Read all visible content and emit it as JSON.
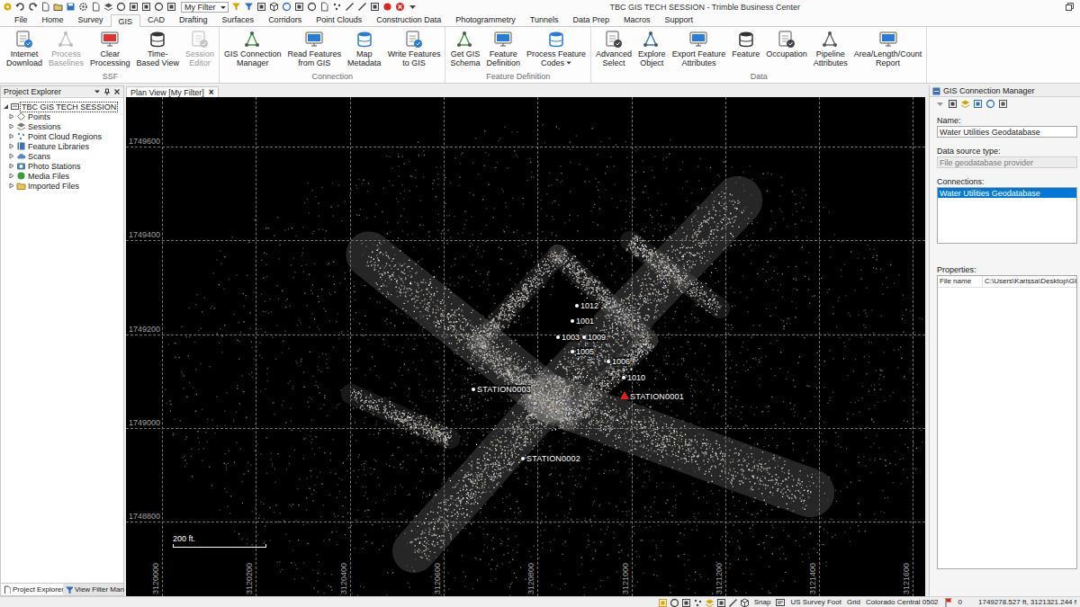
{
  "window": {
    "title": "TBC GIS TECH SESSION - Trimble Business Center"
  },
  "quick_access": {
    "filter": "My Filter"
  },
  "menu_tabs": [
    {
      "label": "File",
      "selected": false
    },
    {
      "label": "Home",
      "selected": false
    },
    {
      "label": "Survey",
      "selected": false
    },
    {
      "label": "GIS",
      "selected": true
    },
    {
      "label": "CAD",
      "selected": false
    },
    {
      "label": "Drafting",
      "selected": false
    },
    {
      "label": "Surfaces",
      "selected": false
    },
    {
      "label": "Corridors",
      "selected": false
    },
    {
      "label": "Point Clouds",
      "selected": false
    },
    {
      "label": "Construction Data",
      "selected": false
    },
    {
      "label": "Photogrammetry",
      "selected": false
    },
    {
      "label": "Tunnels",
      "selected": false
    },
    {
      "label": "Data Prep",
      "selected": false
    },
    {
      "label": "Macros",
      "selected": false
    },
    {
      "label": "Support",
      "selected": false
    }
  ],
  "ribbon": {
    "groups": [
      {
        "label": "SSF",
        "buttons": [
          {
            "lines": [
              "Internet",
              "Download"
            ],
            "disabled": false,
            "dropdown": false
          },
          {
            "lines": [
              "Process",
              "Baselines"
            ],
            "disabled": true,
            "dropdown": false
          },
          {
            "lines": [
              "Clear",
              "Processing"
            ],
            "disabled": false,
            "dropdown": false
          },
          {
            "lines": [
              "Time-",
              "Based View"
            ],
            "disabled": false,
            "dropdown": false
          },
          {
            "lines": [
              "Session",
              "Editor"
            ],
            "disabled": true,
            "dropdown": false
          }
        ]
      },
      {
        "label": "Connection",
        "buttons": [
          {
            "lines": [
              "GIS Connection",
              "Manager"
            ],
            "disabled": false,
            "dropdown": false
          },
          {
            "lines": [
              "Read Features",
              "from GIS"
            ],
            "disabled": false,
            "dropdown": false
          },
          {
            "lines": [
              "Map",
              "Metadata"
            ],
            "disabled": false,
            "dropdown": false
          },
          {
            "lines": [
              "Write Features",
              "to GIS"
            ],
            "disabled": false,
            "dropdown": false
          }
        ]
      },
      {
        "label": "Feature Definition",
        "buttons": [
          {
            "lines": [
              "Get GIS",
              "Schema"
            ],
            "disabled": false,
            "dropdown": false
          },
          {
            "lines": [
              "Feature",
              "Definition"
            ],
            "disabled": false,
            "dropdown": false
          },
          {
            "lines": [
              "Process Feature",
              "Codes"
            ],
            "disabled": false,
            "dropdown": true
          }
        ]
      },
      {
        "label": "Data",
        "buttons": [
          {
            "lines": [
              "Advanced",
              "Select"
            ],
            "disabled": false,
            "dropdown": false
          },
          {
            "lines": [
              "Explore",
              "Object"
            ],
            "disabled": false,
            "dropdown": false
          },
          {
            "lines": [
              "Export Feature",
              "Attributes"
            ],
            "disabled": false,
            "dropdown": false
          },
          {
            "lines": [
              "Feature"
            ],
            "disabled": false,
            "dropdown": false
          },
          {
            "lines": [
              "Occupation"
            ],
            "disabled": false,
            "dropdown": false
          },
          {
            "lines": [
              "Pipeline",
              "Attributes"
            ],
            "disabled": false,
            "dropdown": false
          },
          {
            "lines": [
              "Area/Length/Count",
              "Report"
            ],
            "disabled": false,
            "dropdown": false
          }
        ]
      }
    ]
  },
  "project_explorer": {
    "title": "Project Explorer",
    "root": {
      "label": "TBC GIS TECH SESSION",
      "expanded": true,
      "selected": true
    },
    "items": [
      {
        "label": "Points",
        "expanded": false
      },
      {
        "label": "Sessions",
        "expanded": false
      },
      {
        "label": "Point Cloud Regions",
        "expanded": false
      },
      {
        "label": "Feature Libraries",
        "expanded": false
      },
      {
        "label": "Scans",
        "expanded": false
      },
      {
        "label": "Photo Stations",
        "expanded": false
      },
      {
        "label": "Media Files",
        "expanded": false
      },
      {
        "label": "Imported Files",
        "expanded": false
      }
    ]
  },
  "bottom_tabs": [
    {
      "label": "Project Explorer",
      "selected": true
    },
    {
      "label": "View Filter Man",
      "selected": false
    }
  ],
  "plan_view": {
    "tab": {
      "label": "Plan View [My Filter]",
      "selected": true
    },
    "close": "×",
    "northings": [
      "1749600",
      "1749400",
      "1749200",
      "1749000",
      "1748800"
    ],
    "eastings": [
      "3120000",
      "3120200",
      "3120400",
      "3120600",
      "3120800",
      "3121000",
      "3121200",
      "3121400",
      "3121600"
    ],
    "scale_bar": "200 ft.",
    "points": [
      {
        "label": "1012",
        "kind": "point",
        "color": "#ffffff"
      },
      {
        "label": "1001",
        "kind": "point",
        "color": "#ffffff"
      },
      {
        "label": "1003",
        "kind": "point",
        "color": "#ffffff"
      },
      {
        "label": "1009",
        "kind": "point",
        "color": "#ffffff"
      },
      {
        "label": "1005",
        "kind": "point",
        "color": "#ffffff"
      },
      {
        "label": "1006",
        "kind": "point",
        "color": "#ffffff"
      },
      {
        "label": "1010",
        "kind": "point",
        "color": "#ffffff"
      },
      {
        "label": "STATION0003",
        "kind": "station",
        "color": "#ffffff"
      },
      {
        "label": "STATION0001",
        "kind": "station",
        "color": "#e02020"
      },
      {
        "label": "STATION0002",
        "kind": "station",
        "color": "#ffffff"
      }
    ]
  },
  "gis_panel": {
    "title": "GIS Connection Manager",
    "name_label": "Name:",
    "name": "Water Utilities Geodatabase",
    "source_label": "Data source type:",
    "source": "File geodatabase provider",
    "source_disabled": true,
    "connections_label": "Connections:",
    "connections": [
      {
        "label": "Water Utilities Geodatabase",
        "selected": true
      }
    ],
    "properties_label": "Properties:",
    "properties": [
      {
        "name": "File name",
        "value": "C:\\Users\\Karissa\\Desktop\\GI"
      }
    ]
  },
  "status_bar": {
    "snap": "Snap",
    "units": "US Survey Foot",
    "grid": "Grid",
    "zone": "Colorado Central 0502",
    "count": "0",
    "coordinates": "1749278.527 ft, 3121321.244 f"
  }
}
